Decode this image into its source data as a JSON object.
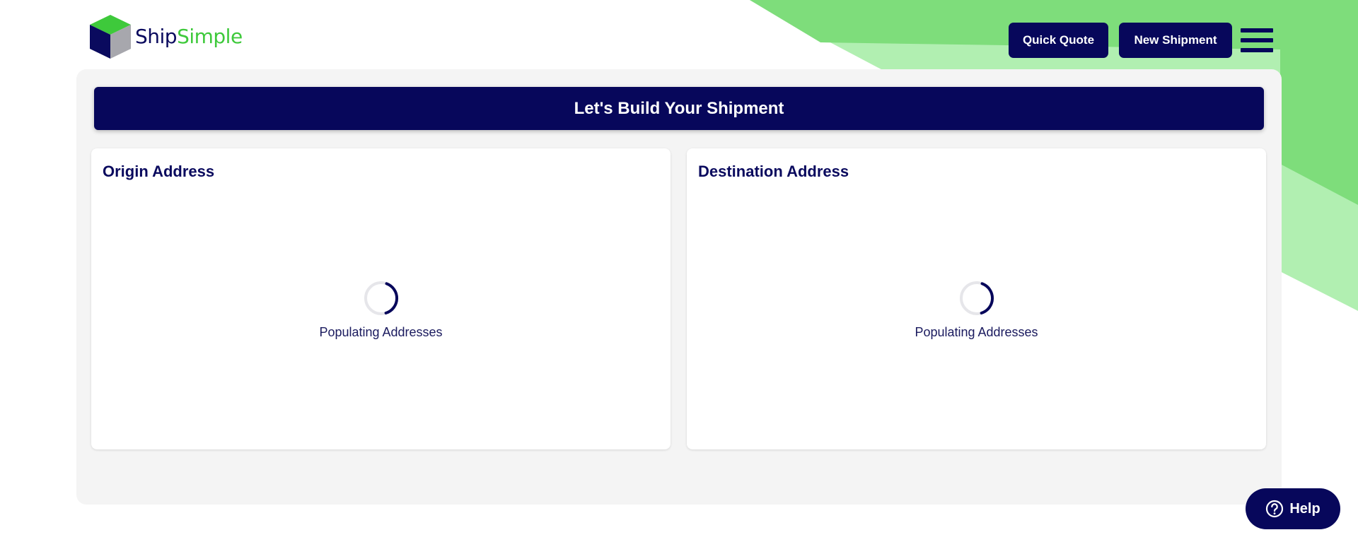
{
  "brand": {
    "name_part1": "Ship",
    "name_part2": "Simple",
    "colors": {
      "navy": "#07075b",
      "green": "#3ec93b",
      "light_green": "#b1efb1",
      "mid_green": "#7edd7b",
      "panel_bg": "#f4f4f4"
    }
  },
  "header": {
    "quick_quote_label": "Quick Quote",
    "new_shipment_label": "New Shipment",
    "menu_icon": "hamburger-menu-icon"
  },
  "banner": {
    "title": "Let's Build Your Shipment"
  },
  "origin": {
    "title": "Origin Address",
    "loading_text": "Populating Addresses"
  },
  "destination": {
    "title": "Destination Address",
    "loading_text": "Populating Addresses"
  },
  "help": {
    "label": "Help",
    "icon": "question-circle-icon"
  }
}
